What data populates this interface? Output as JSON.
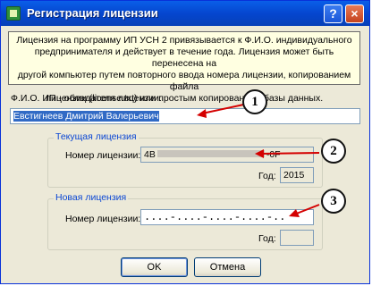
{
  "window": {
    "title": "Регистрация лицензии",
    "help_label": "?",
    "close_label": "×"
  },
  "info": {
    "lines": [
      "Лицензия на программу ИП УСН 2 привязывается к Ф.И.О. индивидуального",
      "предпринимателя и действует в течение года. Лицензия может быть перенесена на",
      "другой компьютер путем повторного ввода номера лицензии, копированием файла",
      "лицензии (license.txt) или простым копированием базы данных."
    ]
  },
  "owner": {
    "label": "Ф.И.О. ИП - обладателя лицензии:",
    "value": "Евстигнеев Дмитрий Валерьевич"
  },
  "current": {
    "group_title": "Текущая лицензия",
    "number_label": "Номер лицензии:",
    "number_prefix": "4B",
    "number_suffix": "-0F",
    "year_label": "Год:",
    "year_value": "2015"
  },
  "new_license": {
    "group_title": "Новая лицензия",
    "number_label": "Номер лицензии:",
    "number_value": "....-....-....-....-..",
    "year_label": "Год:",
    "year_value": ""
  },
  "buttons": {
    "ok": "OK",
    "cancel": "Отмена"
  },
  "callouts": [
    "1",
    "2",
    "3"
  ],
  "colors": {
    "title_bar": "#0546cf",
    "info_bg": "#ffffe1",
    "group_title": "#0a46d4",
    "arrow": "#d40000",
    "dialog_bg": "#ece9d8"
  }
}
